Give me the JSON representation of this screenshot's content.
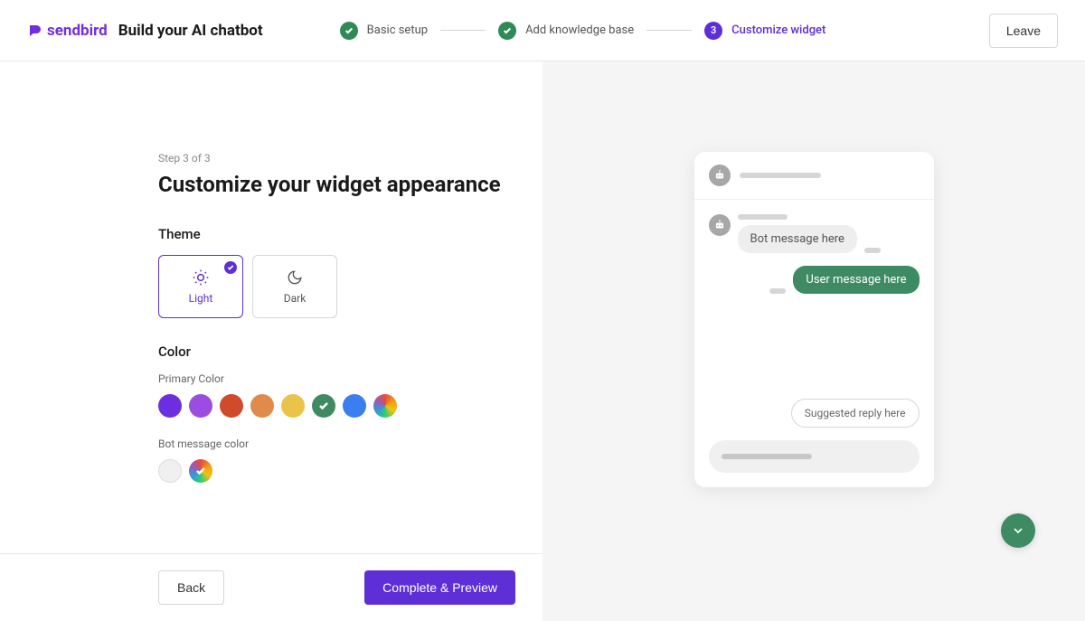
{
  "brand": {
    "name": "sendbird",
    "tagline": "Build your AI chatbot"
  },
  "steps": {
    "items": [
      {
        "label": "Basic setup"
      },
      {
        "label": "Add knowledge base"
      },
      {
        "label": "Customize widget",
        "number": "3"
      }
    ]
  },
  "header": {
    "leave": "Leave"
  },
  "page": {
    "counter": "Step 3 of 3",
    "title": "Customize your widget appearance"
  },
  "theme": {
    "section_label": "Theme",
    "options": [
      {
        "label": "Light"
      },
      {
        "label": "Dark"
      }
    ]
  },
  "color": {
    "section_label": "Color",
    "primary_label": "Primary Color",
    "primary": [
      {
        "hex": "#6b2fe0"
      },
      {
        "hex": "#9b4de0"
      },
      {
        "hex": "#d04a2c"
      },
      {
        "hex": "#e08a4c"
      },
      {
        "hex": "#e9c34a"
      },
      {
        "hex": "#3e8a62",
        "selected": true
      },
      {
        "hex": "#3b7ef0"
      },
      {
        "rainbow": true
      }
    ],
    "bot_label": "Bot message color",
    "bot": [
      {
        "light": true
      },
      {
        "rainbow": true,
        "selected": true
      }
    ]
  },
  "footer": {
    "back": "Back",
    "primary": "Complete & Preview"
  },
  "preview": {
    "bot_message": "Bot message here",
    "user_message": "User message here",
    "suggested": "Suggested reply here",
    "accent": "#3e8a62"
  }
}
